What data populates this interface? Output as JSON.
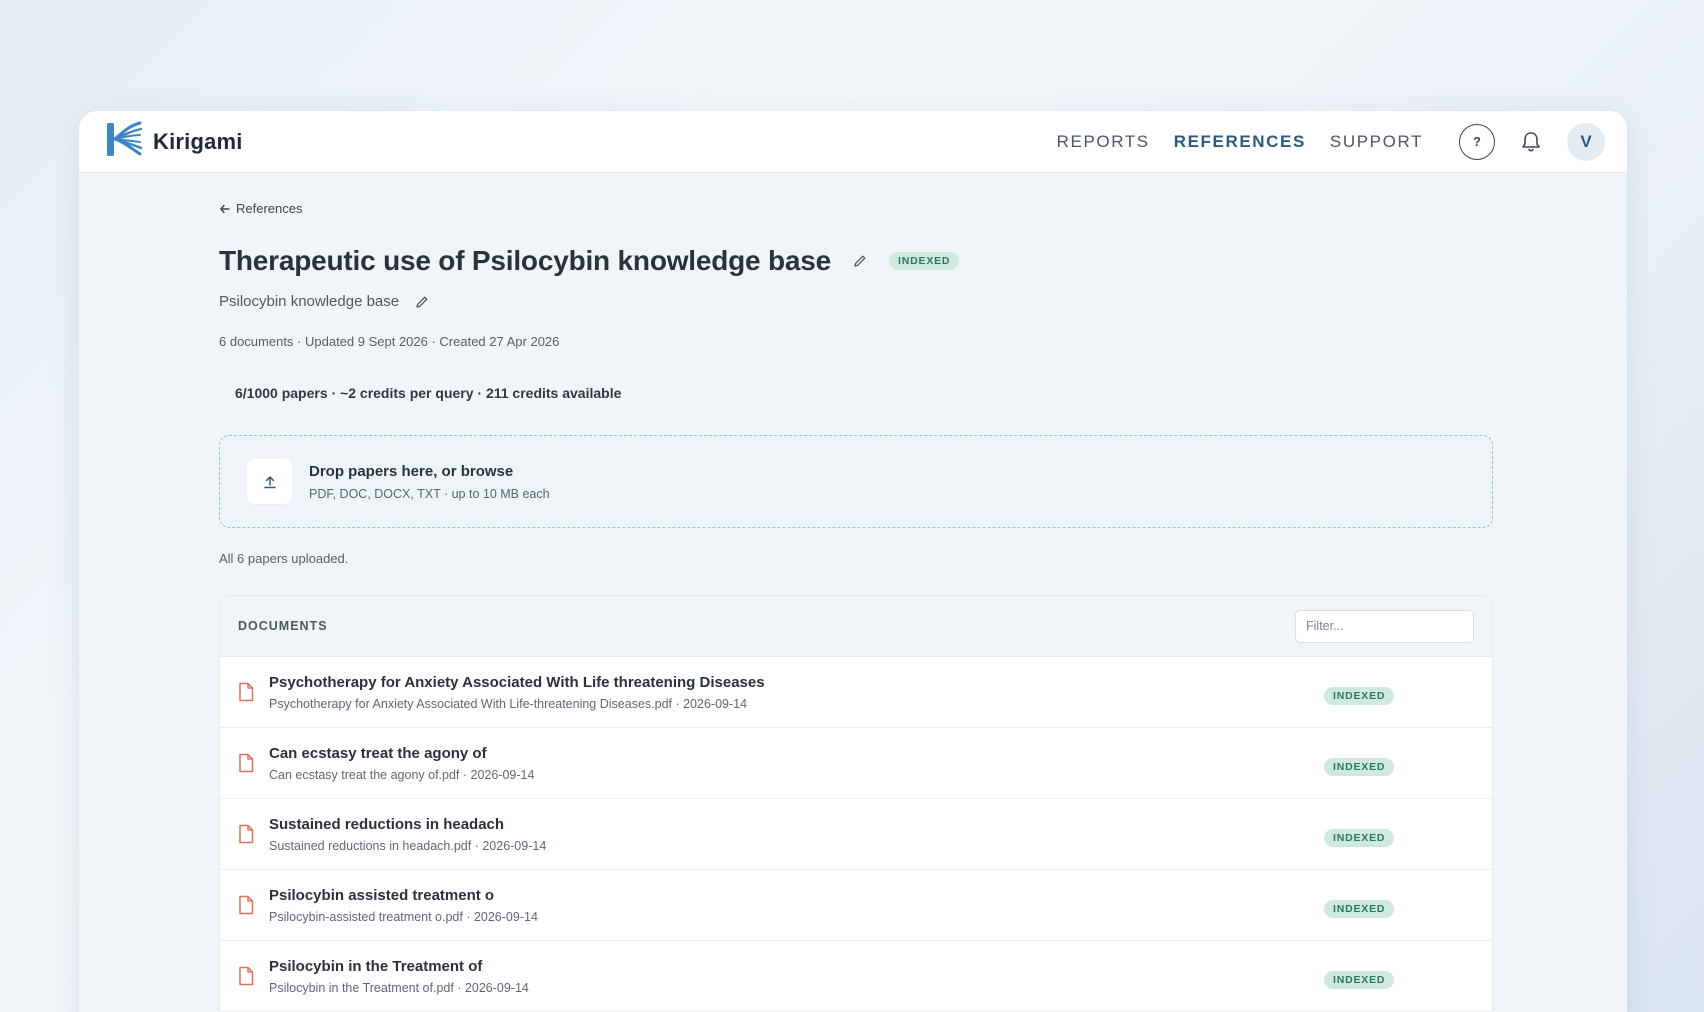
{
  "app": {
    "name": "Kirigami",
    "colors": {
      "brand": "#2d5a7e",
      "logo": "#3f86c1",
      "indexed_bg": "#cfe9df",
      "indexed_text": "#2c7a5c",
      "file_icon": "#e0705d"
    }
  },
  "nav": {
    "items": [
      {
        "label": "REPORTS",
        "active": false
      },
      {
        "label": "REFERENCES",
        "active": true
      },
      {
        "label": "SUPPORT",
        "active": false
      }
    ],
    "help_label": "?",
    "avatar_initial": "V",
    "icons": [
      "help-icon",
      "bell-icon"
    ]
  },
  "page": {
    "back_label": "References",
    "title": "Therapeutic use of Psilocybin knowledge base",
    "status_badge": "INDEXED",
    "subtitle": "Psilocybin knowledge base",
    "meta": "6 documents · Updated 9 Sept 2026 · Created 27 Apr 2026",
    "usage": "6/1000 papers · ~2 credits per query · 211 credits available"
  },
  "dropzone": {
    "title": "Drop papers here, or browse",
    "subtitle": "PDF, DOC, DOCX, TXT · up to 10 MB each",
    "icon": "upload-icon"
  },
  "upload_status": "All 6 papers uploaded.",
  "documents": {
    "header": "DOCUMENTS",
    "filter_placeholder": "Filter...",
    "items": [
      {
        "title": "Psychotherapy for Anxiety Associated With Life threatening Diseases",
        "subtitle": "Psychotherapy for Anxiety Associated With Life-threatening Diseases.pdf · 2026-09-14",
        "status": "INDEXED"
      },
      {
        "title": "Can ecstasy treat the agony of",
        "subtitle": "Can ecstasy treat the agony of.pdf · 2026-09-14",
        "status": "INDEXED"
      },
      {
        "title": "Sustained reductions in headach",
        "subtitle": "Sustained reductions in headach.pdf · 2026-09-14",
        "status": "INDEXED"
      },
      {
        "title": "Psilocybin assisted treatment o",
        "subtitle": "Psilocybin-assisted treatment o.pdf · 2026-09-14",
        "status": "INDEXED"
      },
      {
        "title": "Psilocybin in the Treatment of",
        "subtitle": "Psilocybin in the Treatment of.pdf · 2026-09-14",
        "status": "INDEXED"
      }
    ]
  }
}
